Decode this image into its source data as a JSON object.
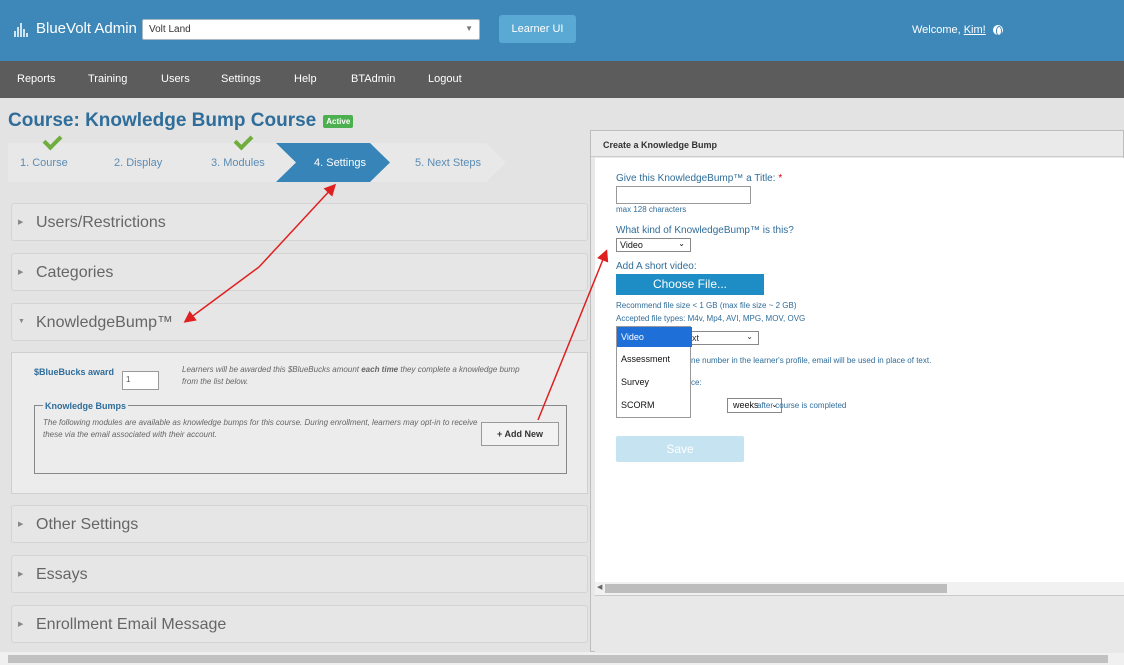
{
  "header": {
    "app_title": "BlueVolt Admin",
    "site_select_value": "Volt Land",
    "learner_ui_label": "Learner UI",
    "welcome_prefix": "Welcome,",
    "user_name": "Kim!"
  },
  "nav": {
    "items": [
      {
        "label": "Reports"
      },
      {
        "label": "Training"
      },
      {
        "label": "Users"
      },
      {
        "label": "Settings"
      },
      {
        "label": "Help"
      },
      {
        "label": "BTAdmin"
      },
      {
        "label": "Logout"
      }
    ]
  },
  "course": {
    "title": "Course: Knowledge Bump Course",
    "status_badge": "Active"
  },
  "steps": [
    {
      "label": "1. Course",
      "completed": true,
      "active": false
    },
    {
      "label": "2. Display",
      "completed": false,
      "active": false
    },
    {
      "label": "3. Modules",
      "completed": true,
      "active": false
    },
    {
      "label": "4. Settings",
      "completed": false,
      "active": true
    },
    {
      "label": "5. Next Steps",
      "completed": false,
      "active": false
    }
  ],
  "accordion": {
    "users_restrictions": "Users/Restrictions",
    "categories": "Categories",
    "knowledgebump": "KnowledgeBump™",
    "other_settings": "Other Settings",
    "essays": "Essays",
    "enrollment_email": "Enrollment Email Message"
  },
  "knowledgebump_panel": {
    "bluebucks_label": "$BlueBucks award",
    "bluebucks_value": "1",
    "bluebucks_desc_a": "Learners will be awarded this $BlueBucks amount ",
    "bluebucks_desc_b": "each time",
    "bluebucks_desc_c": " they complete a knowledge bump from the list below.",
    "fieldset_legend": "Knowledge Bumps",
    "fieldset_desc": "The following modules are available as knowledge bumps for this course. During enrollment, learners may opt-in to receive these via the email associated with their account.",
    "add_new_label": "+ Add New"
  },
  "dialog": {
    "title": "Create a Knowledge Bump",
    "title_prompt": "Give this KnowledgeBump™ a Title:",
    "required_mark": "*",
    "max_chars_hint": "max 128 characters",
    "kind_prompt": "What kind of KnowledgeBump™ is this?",
    "kind_value": "Video",
    "add_video_label": "Add A short video:",
    "choose_file_label": "Choose File...",
    "file_size_hint": "Recommend file size < 1 GB (max file size ~ 2 GB)",
    "file_types_hint": "Accepted file types: M4v, Mp4, AVI, MPG, MOV, OVG",
    "dropdown_options": [
      "Video",
      "Assessment",
      "Survey",
      "SCORM"
    ],
    "behind_select_fragment": "xt",
    "behind_text_1": "ne number in the learner's profile, email will be used in place of text.",
    "behind_text_2": "ce:",
    "weeks_value": "weeks",
    "after_completed": "after course is completed",
    "save_label": "Save"
  },
  "colors": {
    "header_blue": "#3d88b8",
    "nav_gray": "#5c5c5c",
    "accent_blue": "#2f6d9a",
    "active_step": "#3785b8",
    "check_green": "#6fae3e",
    "annotation_red": "#e02020"
  }
}
